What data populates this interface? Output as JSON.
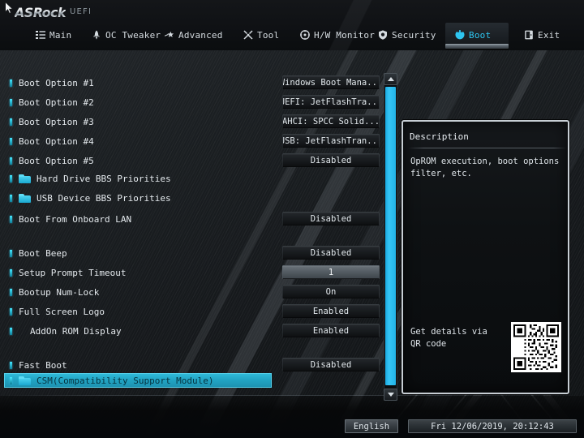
{
  "brand": {
    "name": "ASRock",
    "suffix": "UEFI"
  },
  "menu": {
    "tabs": [
      {
        "label": "Main",
        "icon": "list-icon",
        "active": false
      },
      {
        "label": "OC Tweaker",
        "icon": "rocket-icon",
        "active": false
      },
      {
        "label": "Advanced",
        "icon": "star-arrow-icon",
        "active": false
      },
      {
        "label": "Tool",
        "icon": "tools-icon",
        "active": false
      },
      {
        "label": "H/W Monitor",
        "icon": "gauge-icon",
        "active": false
      },
      {
        "label": "Security",
        "icon": "shield-icon",
        "active": false
      },
      {
        "label": "Boot",
        "icon": "power-icon",
        "active": true
      },
      {
        "label": "Exit",
        "icon": "exit-door-icon",
        "active": false
      }
    ]
  },
  "settings": [
    {
      "label": "Boot Option #1",
      "value": "Windows Boot Mana...",
      "type": "select",
      "icon": "bullet"
    },
    {
      "label": "Boot Option #2",
      "value": "UEFI: JetFlashTra...",
      "type": "select",
      "icon": "bullet"
    },
    {
      "label": "Boot Option #3",
      "value": "AHCI:  SPCC Solid...",
      "type": "select",
      "icon": "bullet"
    },
    {
      "label": "Boot Option #4",
      "value": "USB: JetFlashTran...",
      "type": "select",
      "icon": "bullet"
    },
    {
      "label": "Boot Option #5",
      "value": "Disabled",
      "type": "select",
      "icon": "bullet"
    },
    {
      "label": "Hard Drive BBS Priorities",
      "value": "",
      "type": "submenu",
      "icon": "folder"
    },
    {
      "label": "USB Device BBS Priorities",
      "value": "",
      "type": "submenu",
      "icon": "folder"
    },
    {
      "label": "Boot From Onboard LAN",
      "value": "Disabled",
      "type": "select",
      "icon": "bullet"
    },
    {
      "label": "Boot Beep",
      "value": "Disabled",
      "type": "select",
      "icon": "bullet"
    },
    {
      "label": "Setup Prompt Timeout",
      "value": "1",
      "type": "field",
      "icon": "bullet"
    },
    {
      "label": "Bootup Num-Lock",
      "value": "On",
      "type": "select",
      "icon": "bullet"
    },
    {
      "label": "Full Screen Logo",
      "value": "Enabled",
      "type": "select",
      "icon": "bullet"
    },
    {
      "label": "AddOn ROM Display",
      "value": "Enabled",
      "type": "select",
      "icon": "bullet",
      "indent": true
    },
    {
      "label": "Fast Boot",
      "value": "Disabled",
      "type": "select",
      "icon": "bullet"
    },
    {
      "label": "CSM(Compatibility Support Module)",
      "value": "",
      "type": "submenu",
      "icon": "folder",
      "selected": true
    }
  ],
  "description": {
    "title": "Description",
    "body": "OpROM execution, boot options filter, etc.",
    "qr_label": "Get details via QR code"
  },
  "footer": {
    "language": "English",
    "datetime": "Fri 12/06/2019, 20:12:43"
  },
  "colors": {
    "accent": "#2ec5f0",
    "highlight": "#22a4c4",
    "highlight_text": "#06333f",
    "text": "#e4e9ed",
    "background": "#16191c"
  }
}
